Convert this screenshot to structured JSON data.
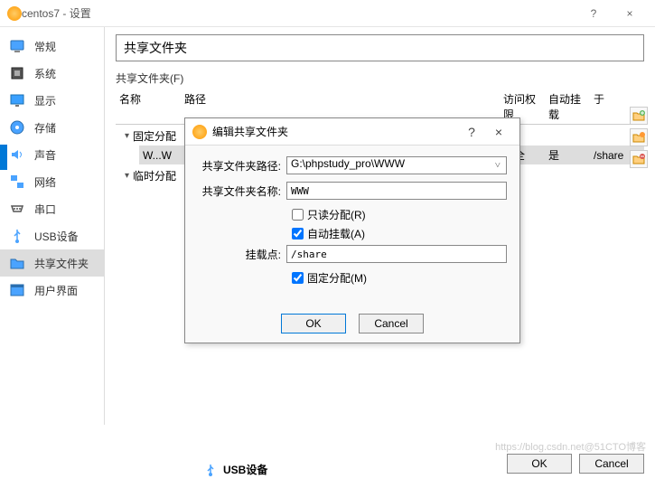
{
  "window": {
    "title": "centos7 - 设置",
    "help": "?",
    "close": "×"
  },
  "sidebar": {
    "items": [
      {
        "label": "常规"
      },
      {
        "label": "系统"
      },
      {
        "label": "显示"
      },
      {
        "label": "存储"
      },
      {
        "label": "声音"
      },
      {
        "label": "网络"
      },
      {
        "label": "串口"
      },
      {
        "label": "USB设备"
      },
      {
        "label": "共享文件夹"
      },
      {
        "label": "用户界面"
      }
    ]
  },
  "main": {
    "title": "共享文件夹",
    "fieldset": "共享文件夹(F)",
    "columns": {
      "name": "名称",
      "path": "路径",
      "access": "访问权限",
      "auto": "自动挂载",
      "mount": "于"
    },
    "tree": {
      "fixed": "固定分配",
      "temp": "临时分配"
    },
    "row": {
      "name": "W...W",
      "path": "",
      "access": "完全",
      "auto": "是",
      "mount": "/share"
    }
  },
  "dialog": {
    "title": "编辑共享文件夹",
    "help": "?",
    "close": "×",
    "path_label": "共享文件夹路径:",
    "path_value": "G:\\phpstudy_pro\\WWW",
    "name_label": "共享文件夹名称:",
    "name_value": "WWW",
    "readonly": "只读分配(R)",
    "automount": "自动挂载(A)",
    "mountpoint_label": "挂载点:",
    "mountpoint_value": "/share",
    "permanent": "固定分配(M)",
    "ok": "OK",
    "cancel": "Cancel"
  },
  "footer": {
    "ok": "OK",
    "cancel": "Cancel"
  },
  "watermark": "https://blog.csdn.net@51CTO博客",
  "truncated": "USB设备"
}
